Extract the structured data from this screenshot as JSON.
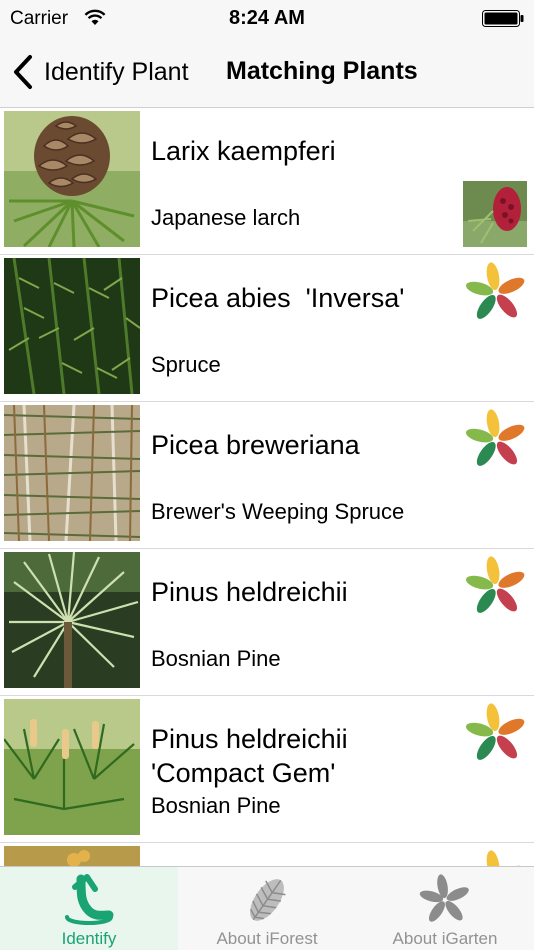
{
  "status_bar": {
    "carrier": "Carrier",
    "time": "8:24 AM"
  },
  "nav": {
    "back_label": "Identify Plant",
    "title": "Matching Plants"
  },
  "plants": [
    {
      "name": "Larix kaempferi",
      "common": "Japanese larch",
      "badge": "photo"
    },
    {
      "name": "Picea abies  'Inversa'",
      "common": "Spruce",
      "badge": "igarten-logo"
    },
    {
      "name": "Picea breweriana",
      "common": "Brewer's Weeping Spruce",
      "badge": "igarten-logo"
    },
    {
      "name": "Pinus heldreichii",
      "common": "Bosnian Pine",
      "badge": "igarten-logo"
    },
    {
      "name": "Pinus heldreichii\n'Compact Gem'",
      "common": "Bosnian Pine",
      "badge": "igarten-logo"
    }
  ],
  "tabs": [
    {
      "label": "Identify",
      "icon": "identify-icon",
      "active": true
    },
    {
      "label": "About iForest",
      "icon": "pinecone-icon",
      "active": false
    },
    {
      "label": "About iGarten",
      "icon": "flower-icon",
      "active": false
    }
  ],
  "colors": {
    "accent": "#1aa373",
    "logo_yellow": "#f3c13a",
    "logo_orange": "#e0782b",
    "logo_red": "#c5404e",
    "logo_green": "#2a8a52",
    "logo_lightgreen": "#86b94b"
  }
}
